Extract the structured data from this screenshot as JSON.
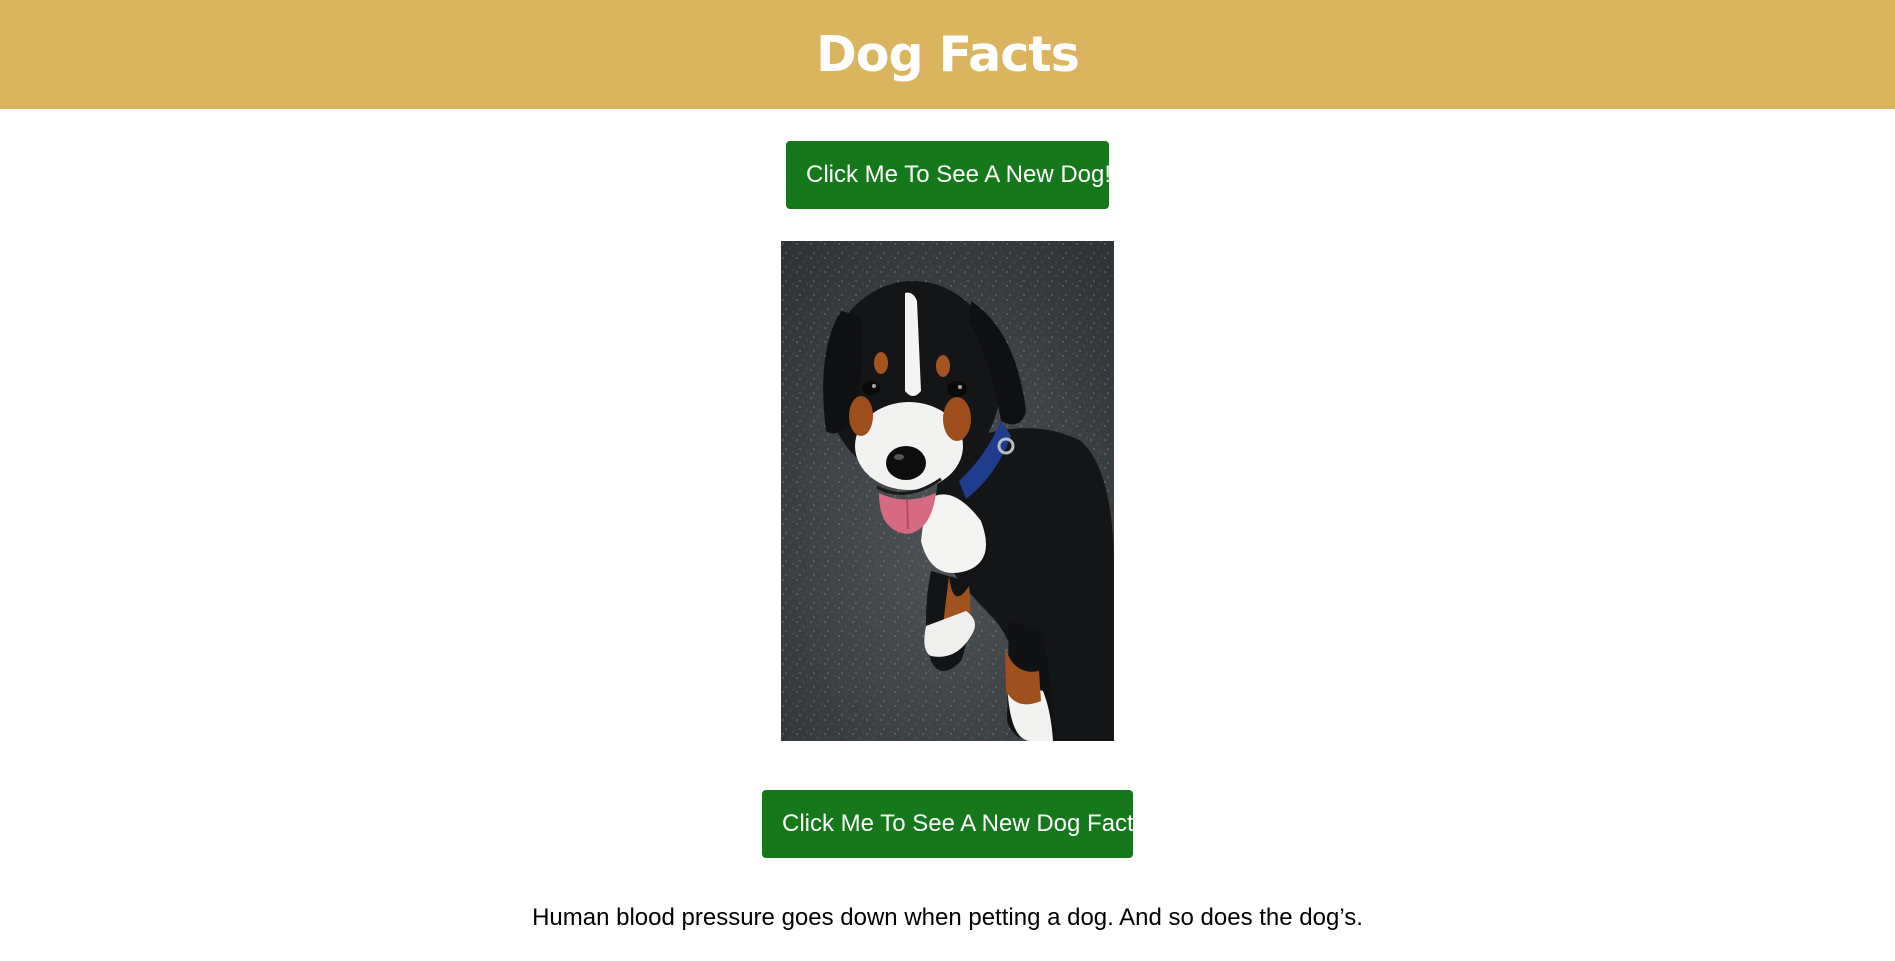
{
  "theme": {
    "header_bg": "#dbb45f",
    "button_bg": "#15781a"
  },
  "header": {
    "title": "Dog Facts"
  },
  "main": {
    "new_dog_button_label": "Click Me To See A New Dog!",
    "dog_image": {
      "alt": "Puppy with a blue collar standing on asphalt"
    },
    "new_fact_button_label": "Click Me To See A New Dog Fact!",
    "fact": "Human blood pressure goes down when petting a dog. And so does the dog’s."
  }
}
